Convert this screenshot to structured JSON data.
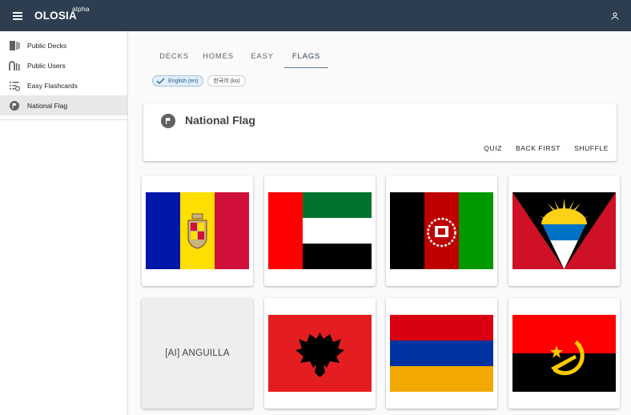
{
  "app": {
    "title": "OLOSIA",
    "badge": "alpha"
  },
  "sidebar": {
    "items": [
      {
        "label": "Public Decks",
        "icon": "decks-icon"
      },
      {
        "label": "Public Users",
        "icon": "users-icon"
      },
      {
        "label": "Easy Flashcards",
        "icon": "playlist-icon"
      },
      {
        "label": "National Flag",
        "icon": "flag-icon",
        "active": true
      }
    ]
  },
  "tabs": [
    {
      "label": "DECKS"
    },
    {
      "label": "HOMES"
    },
    {
      "label": "EASY"
    },
    {
      "label": "FLAGS",
      "active": true
    }
  ],
  "chips": [
    {
      "label": "English (en)",
      "selected": true
    },
    {
      "label": "한국어 (ko)",
      "selected": false
    }
  ],
  "deck": {
    "title": "National Flag",
    "actions": {
      "quiz": "QUIZ",
      "back_first": "BACK FIRST",
      "shuffle": "SHUFFLE"
    }
  },
  "cards": [
    {
      "flag": "andorra-flag"
    },
    {
      "flag": "united-arab-emirates-flag"
    },
    {
      "flag": "afghanistan-flag"
    },
    {
      "flag": "antigua-and-barbuda-flag"
    },
    {
      "text": "[AI] ANGUILLA"
    },
    {
      "flag": "albania-flag"
    },
    {
      "flag": "armenia-flag"
    },
    {
      "flag": "angola-flag"
    }
  ],
  "colors": {
    "appbar": "#2c3e50",
    "accent": "#607d8b"
  }
}
